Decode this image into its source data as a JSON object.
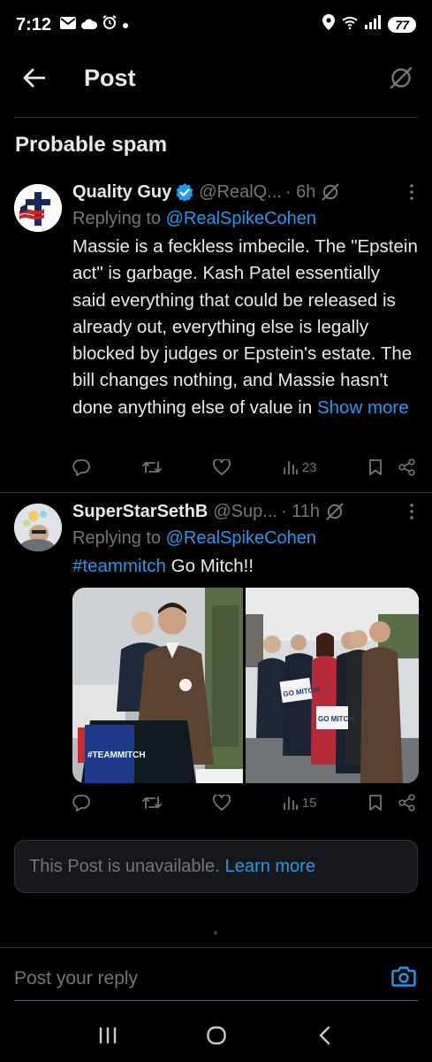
{
  "status_bar": {
    "time": "7:12",
    "battery": "77"
  },
  "header": {
    "title": "Post"
  },
  "section": {
    "title": "Probable spam"
  },
  "posts": [
    {
      "author": "Quality Guy",
      "verified": true,
      "handle": "@RealQ...",
      "time": "· 6h",
      "replying_prefix": "Replying to ",
      "replying_to": "@RealSpikeCohen",
      "text": "Massie is a feckless imbecile. The \"Epstein act\" is garbage. Kash Patel essentially said everything that could be released is already out, everything else is legally blocked by judges or Epstein's estate. The bill changes nothing, and Massie hasn't done anything else of value in",
      "show_more": "Show more",
      "views": "23"
    },
    {
      "author": "SuperStarSethB",
      "verified": false,
      "handle": "@Sup...",
      "time": "· 11h",
      "replying_prefix": "Replying to ",
      "replying_to": "@RealSpikeCohen",
      "hashtag": "#teammitch",
      "text": " Go Mitch!!",
      "photo_sign_left": "#TEAMMITCH",
      "photo_sign_right_1": "GO MITCH!",
      "photo_sign_right_2": "GO MITCH!",
      "views": "15"
    }
  ],
  "unavailable": {
    "text": "This Post is unavailable. ",
    "link": "Learn more"
  },
  "reply": {
    "placeholder": "Post your reply"
  },
  "colors": {
    "background": "#000000",
    "accent": "#1d9bf0",
    "muted": "#71767b",
    "text": "#e7e9ea",
    "divider": "#2f3336"
  }
}
